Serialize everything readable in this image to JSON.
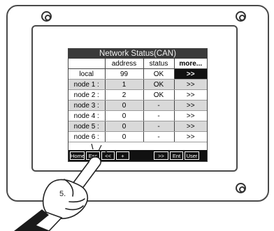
{
  "screen": {
    "title": "Network Status(CAN)",
    "headers": [
      "",
      "address",
      "status",
      "more..."
    ],
    "rows": [
      {
        "name": "local",
        "address": "99",
        "status": "OK",
        "more": ">>"
      },
      {
        "name": "node 1 :",
        "address": "1",
        "status": "OK",
        "more": ">>"
      },
      {
        "name": "node 2 :",
        "address": "2",
        "status": "OK",
        "more": ">>"
      },
      {
        "name": "node 3 :",
        "address": "0",
        "status": "-",
        "more": ">>"
      },
      {
        "name": "node 4 :",
        "address": "0",
        "status": "-",
        "more": ">>"
      },
      {
        "name": "node 5 :",
        "address": "0",
        "status": "-",
        "more": ">>"
      },
      {
        "name": "node 6 :",
        "address": "0",
        "status": "-",
        "more": ">>"
      }
    ],
    "softkeys": {
      "home": "Home",
      "esc": "Esc",
      "prev": "<<",
      "plus": "+",
      "next": ">>",
      "ent": "Ent",
      "user": "User"
    }
  },
  "annotation": {
    "step": "5."
  },
  "colors": {
    "title_bg": "#3a3a3a",
    "selected_cell": "#111111",
    "alt_row": "#d9d9d9",
    "softkey_bar": "#111111"
  }
}
